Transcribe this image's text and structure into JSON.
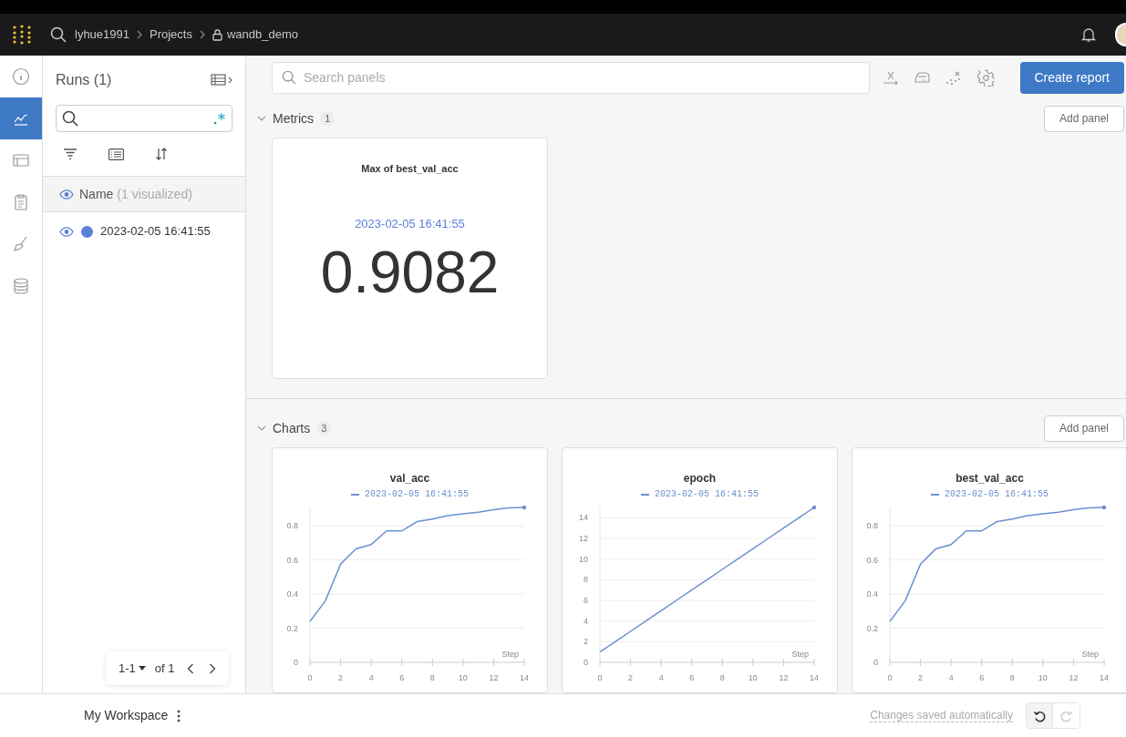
{
  "header": {
    "breadcrumbs": [
      "lyhue1991",
      "Projects"
    ],
    "project": "wandb_demo"
  },
  "nav": [
    {
      "kind": "info",
      "selected": false
    },
    {
      "kind": "charts",
      "selected": true
    },
    {
      "kind": "table",
      "selected": false
    },
    {
      "kind": "report",
      "selected": false
    },
    {
      "kind": "sweep",
      "selected": false
    },
    {
      "kind": "artifacts",
      "selected": false
    }
  ],
  "runs_panel": {
    "title": "Runs (1)",
    "column": {
      "label": "Name",
      "note": "(1 visualized)"
    },
    "runs": [
      {
        "name": "2023-02-05 16:41:55",
        "visible": true,
        "color": "#5b82d6"
      }
    ],
    "pagination": {
      "range": "1-1",
      "total": "of 1"
    }
  },
  "toolbar": {
    "search_placeholder": "Search panels",
    "button": "Create report"
  },
  "sections": [
    {
      "title": "Metrics",
      "count": "1",
      "expanded": true,
      "add_button": "Add panel",
      "panels": [
        {
          "kind": "scalar",
          "title": "Max of best_val_acc",
          "run": "2023-02-05 16:41:55",
          "value": "0.9082"
        }
      ]
    },
    {
      "title": "Charts",
      "count": "3",
      "expanded": true,
      "add_button": "Add panel",
      "panels": [
        {
          "kind": "line",
          "chart_data": {
            "type": "line",
            "title": "val_acc",
            "xlabel": "Step",
            "x": [
              0,
              1,
              2,
              3,
              4,
              5,
              6,
              7,
              8,
              9,
              10,
              11,
              12,
              13,
              14
            ],
            "xlim": [
              0,
              14
            ],
            "ylim": [
              0,
              0.908
            ],
            "grid": true,
            "xticks": [
              0,
              2,
              4,
              6,
              8,
              10,
              12,
              14
            ],
            "yticks": [
              0,
              0.2,
              0.4,
              0.6,
              0.8
            ],
            "series": [
              {
                "name": "2023-02-05 16:41:55",
                "color": "#6b8fd0",
                "values": [
                  0.24,
                  0.36,
                  0.575,
                  0.665,
                  0.69,
                  0.77,
                  0.77,
                  0.825,
                  0.84,
                  0.86,
                  0.87,
                  0.88,
                  0.895,
                  0.905,
                  0.908
                ]
              }
            ]
          }
        },
        {
          "kind": "line",
          "chart_data": {
            "type": "line",
            "title": "epoch",
            "xlabel": "Step",
            "x": [
              0,
              1,
              2,
              3,
              4,
              5,
              6,
              7,
              8,
              9,
              10,
              11,
              12,
              13,
              14
            ],
            "xlim": [
              0,
              14
            ],
            "ylim": [
              0,
              15
            ],
            "grid": true,
            "xticks": [
              0,
              2,
              4,
              6,
              8,
              10,
              12,
              14
            ],
            "yticks": [
              0,
              2,
              4,
              6,
              8,
              10,
              12,
              14
            ],
            "series": [
              {
                "name": "2023-02-05 16:41:55",
                "color": "#6b8fd0",
                "values": [
                  1,
                  2,
                  3,
                  4,
                  5,
                  6,
                  7,
                  8,
                  9,
                  10,
                  11,
                  12,
                  13,
                  14,
                  15
                ]
              }
            ]
          }
        },
        {
          "kind": "line",
          "chart_data": {
            "type": "line",
            "title": "best_val_acc",
            "xlabel": "Step",
            "x": [
              0,
              1,
              2,
              3,
              4,
              5,
              6,
              7,
              8,
              9,
              10,
              11,
              12,
              13,
              14
            ],
            "xlim": [
              0,
              14
            ],
            "ylim": [
              0,
              0.908
            ],
            "grid": true,
            "xticks": [
              0,
              2,
              4,
              6,
              8,
              10,
              12,
              14
            ],
            "yticks": [
              0,
              0.2,
              0.4,
              0.6,
              0.8
            ],
            "series": [
              {
                "name": "2023-02-05 16:41:55",
                "color": "#6b8fd0",
                "values": [
                  0.24,
                  0.36,
                  0.575,
                  0.665,
                  0.69,
                  0.77,
                  0.77,
                  0.825,
                  0.84,
                  0.86,
                  0.87,
                  0.88,
                  0.895,
                  0.905,
                  0.908
                ]
              }
            ]
          }
        }
      ]
    }
  ],
  "footer": {
    "workspace": "My Workspace",
    "save_status": "Changes saved automatically",
    "undo_disabled": false,
    "redo_disabled": true
  }
}
